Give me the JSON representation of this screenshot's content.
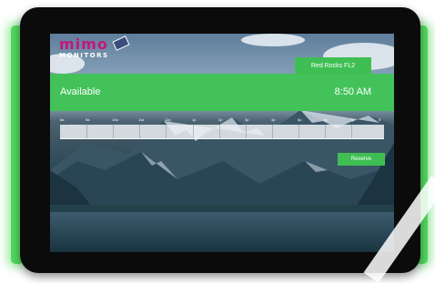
{
  "logo": {
    "word": "mimo",
    "sub": "MONITORS"
  },
  "room": {
    "name": "Red Rocks FL2"
  },
  "status": {
    "availability": "Available",
    "time": "8:50 AM"
  },
  "timeline": {
    "hours": [
      "8a",
      "9a",
      "10a",
      "11a",
      "12p",
      "1p",
      "2p",
      "3p",
      "4p",
      "5p",
      "6p",
      "7p",
      "8"
    ]
  },
  "actions": {
    "reserve_label": "Reserve"
  },
  "colors": {
    "accent_green": "#43c25a",
    "bezel": "#0b0b0c",
    "glow": "#52d860",
    "logo_magenta": "#c2187d"
  }
}
